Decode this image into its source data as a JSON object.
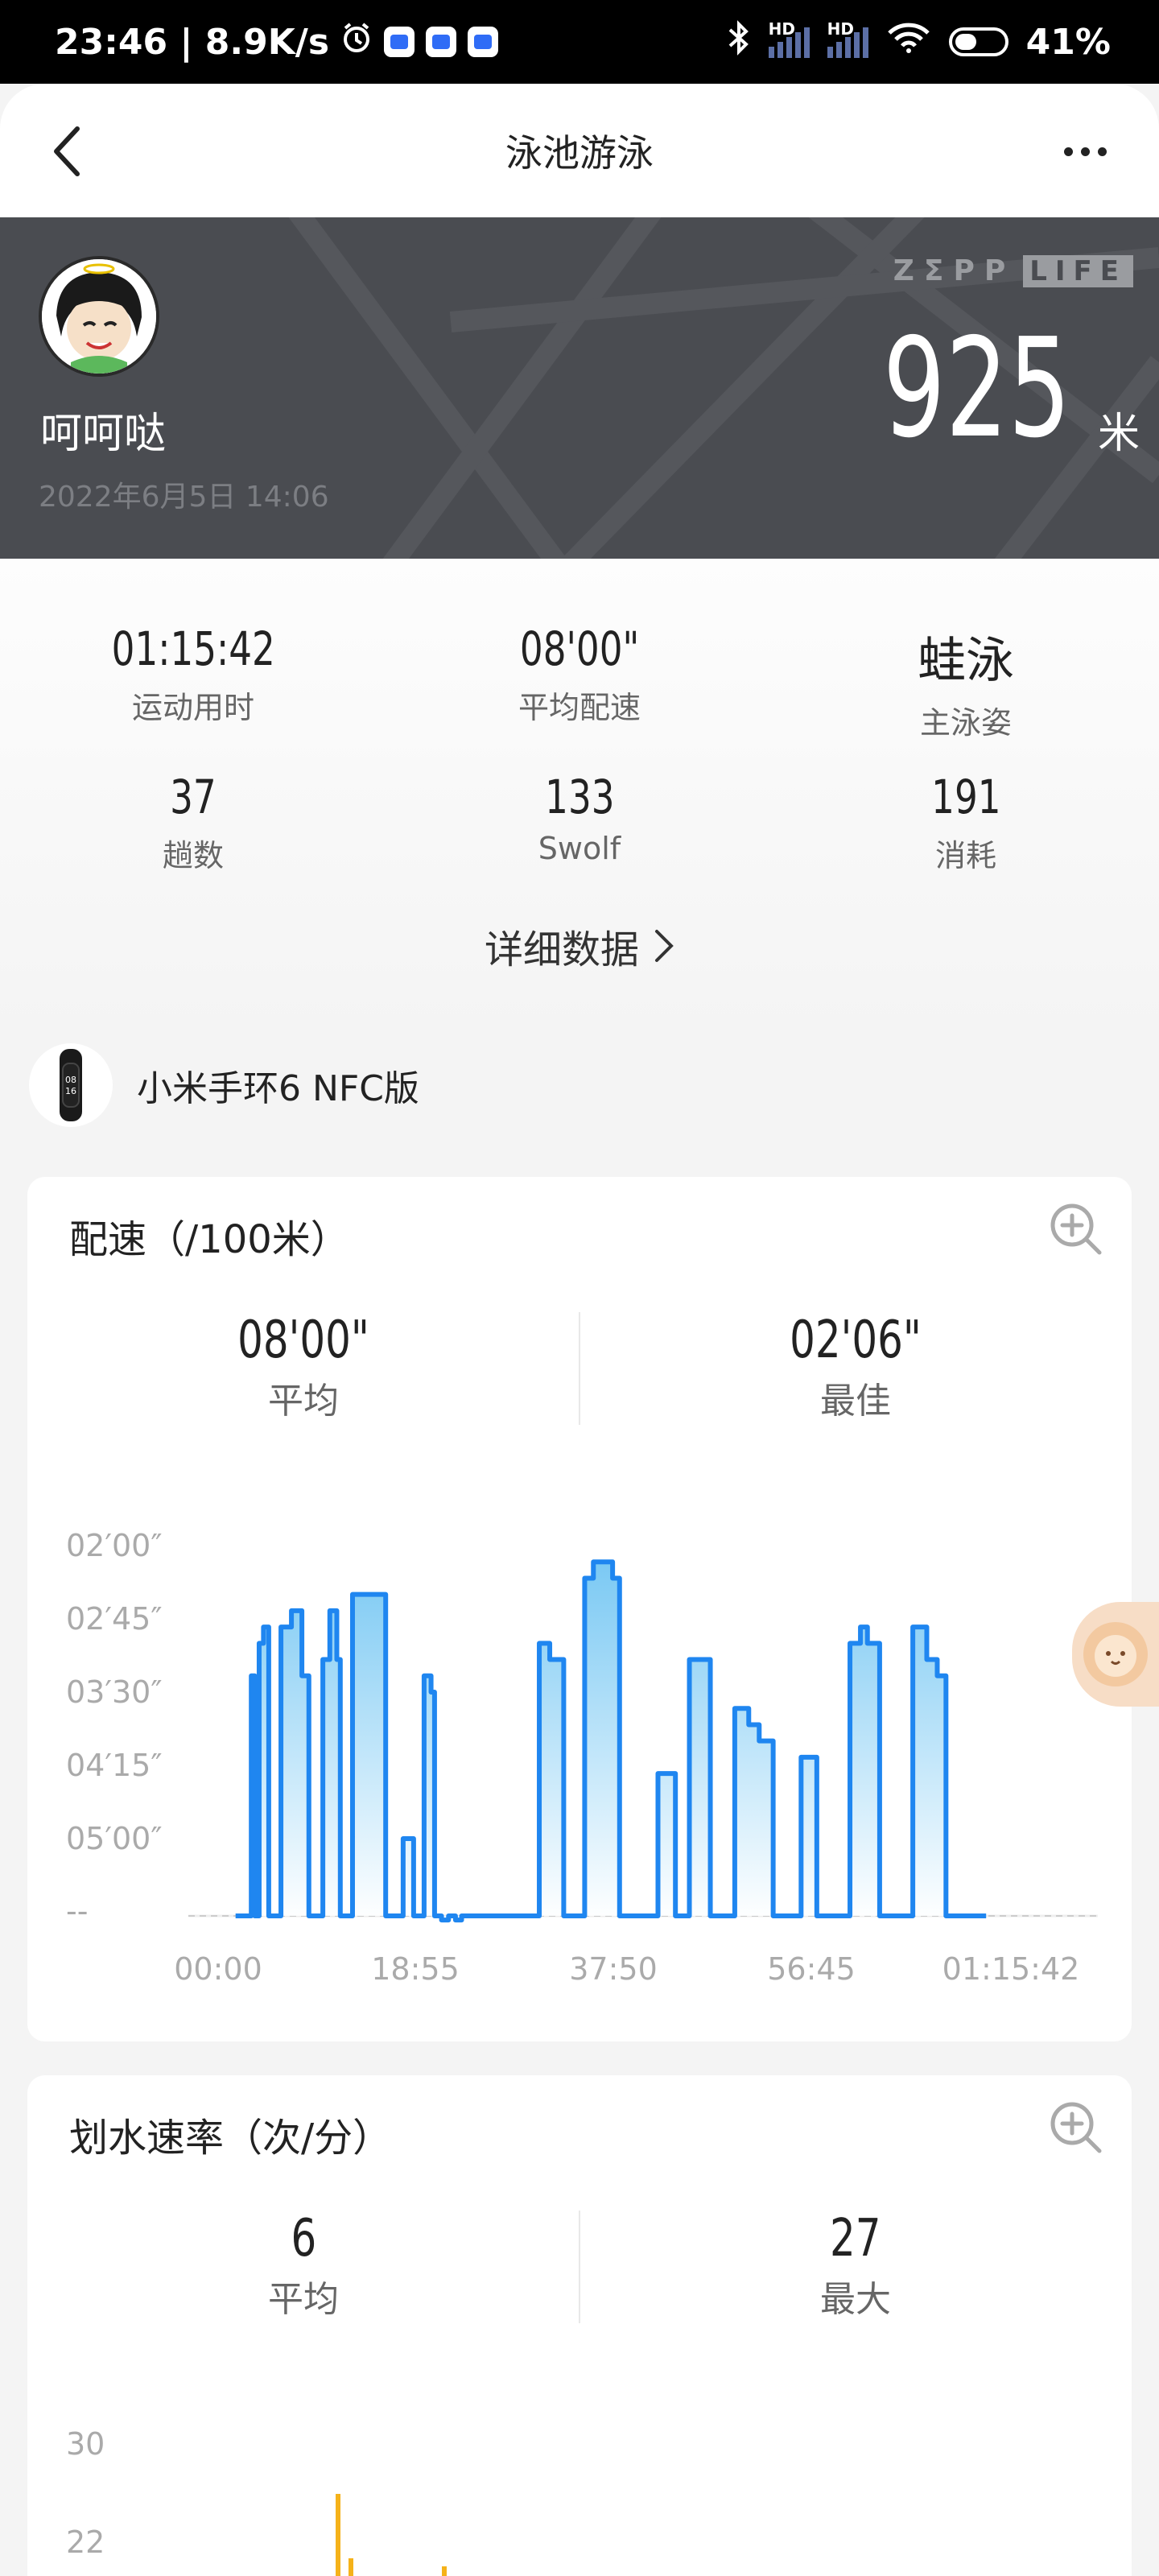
{
  "status_bar": {
    "time_speed": "23:46 | 8.9K/s",
    "signal_label_1": "HD",
    "signal_label_2": "HD",
    "battery": "41%"
  },
  "nav": {
    "title": "泳池游泳"
  },
  "hero": {
    "username": "呵呵哒",
    "datetime": "2022年6月5日 14:06",
    "brand_a": "ZΣPP",
    "brand_b": "LIFE",
    "distance": "925",
    "distance_unit": "米"
  },
  "stats": [
    {
      "value": "01:15:42",
      "label": "运动用时"
    },
    {
      "value": "08'00\"",
      "label": "平均配速"
    },
    {
      "value": "蛙泳",
      "label": "主泳姿"
    },
    {
      "value": "37",
      "label": "趟数"
    },
    {
      "value": "133",
      "label": "Swolf"
    },
    {
      "value": "191",
      "label": "消耗"
    }
  ],
  "detail_link": "详细数据",
  "device": {
    "name": "小米手环6 NFC版",
    "screen_text_1": "08",
    "screen_text_2": "16"
  },
  "pace_card": {
    "title": "配速（/100米）",
    "avg_value": "08'00\"",
    "avg_label": "平均",
    "best_value": "02'06\"",
    "best_label": "最佳",
    "y_ticks": [
      "02′00″",
      "02′45″",
      "03′30″",
      "04′15″",
      "05′00″",
      "--"
    ],
    "x_ticks": [
      "00:00",
      "18:55",
      "37:50",
      "56:45",
      "01:15:42"
    ],
    "line_color": "#1f86f0"
  },
  "stroke_card": {
    "title": "划水速率（次/分）",
    "avg_value": "6",
    "avg_label": "平均",
    "max_value": "27",
    "max_label": "最大",
    "y_ticks": [
      "30",
      "22"
    ],
    "bar_color": "#f5b21a"
  },
  "chart_data": [
    {
      "type": "area",
      "title": "配速（/100米）",
      "y_ticks": [
        "02′00″",
        "02′45″",
        "03′30″",
        "04′15″",
        "05′00″",
        "--"
      ],
      "x_ticks": [
        "00:00",
        "18:55",
        "37:50",
        "56:45",
        "01:15:42"
      ],
      "xlabel": "",
      "ylabel": "",
      "grid": false,
      "series": [
        {
          "x_seconds": [
            100,
            140,
            170,
            190,
            210,
            235,
            260,
            290,
            330,
            360,
            420,
            480,
            520,
            560,
            600,
            640,
            680,
            700,
            740,
            770,
            800,
            830,
            880,
            940,
            960,
            1000,
            1060,
            1120,
            1150,
            1180,
            1220,
            1240,
            1265,
            1280,
            1320,
            1360,
            1395,
            1430,
            1465,
            1560,
            1680,
            1720,
            1760,
            1800,
            1840,
            1900,
            1980,
            2050,
            2100,
            2150,
            2200,
            2260,
            2300,
            2340,
            2380,
            2420,
            2460,
            2520,
            2620,
            2700,
            2760,
            2820,
            2880,
            2960,
            3040,
            3100,
            3180,
            3260,
            3340,
            3430,
            3520,
            3580,
            3620,
            3680,
            3720,
            3790,
            3860,
            3900,
            3980,
            4060,
            4120,
            4170,
            4220,
            4280,
            4330,
            4400
          ],
          "pace_seconds": [
            360,
            360,
            360,
            200,
            360,
            180,
            170,
            360,
            360,
            170,
            160,
            200,
            360,
            360,
            190,
            160,
            190,
            360,
            360,
            150,
            150,
            150,
            150,
            150,
            360,
            360,
            300,
            360,
            360,
            200,
            210,
            360,
            360,
            350,
            360,
            350,
            360,
            360,
            360,
            360,
            360,
            360,
            360,
            360,
            180,
            190,
            360,
            360,
            140,
            130,
            130,
            140,
            360,
            360,
            360,
            360,
            360,
            260,
            360,
            190,
            190,
            360,
            360,
            220,
            230,
            240,
            360,
            360,
            250,
            360,
            360,
            360,
            180,
            170,
            180,
            360,
            360,
            360,
            170,
            190,
            200,
            360,
            360,
            360,
            360,
            360
          ]
        }
      ]
    }
  ]
}
